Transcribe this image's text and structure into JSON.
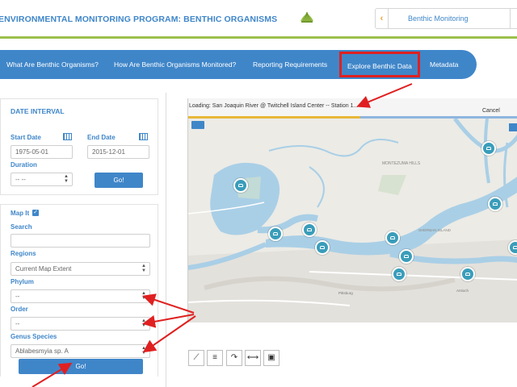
{
  "header": {
    "title": "ENVIRONMENTAL MONITORING PROGRAM: BENTHIC ORGANISMS",
    "program_selector": {
      "value": "Benthic Monitoring",
      "prev_icon": "chevron-left-icon"
    },
    "logo_icon": "shell-logo-icon"
  },
  "nav": {
    "tabs": [
      {
        "label": "What Are Benthic Organisms?"
      },
      {
        "label": "How Are Benthic Organisms Monitored?"
      },
      {
        "label": "Reporting Requirements"
      },
      {
        "label": "Explore Benthic Data",
        "active": true
      },
      {
        "label": "Metadata"
      }
    ]
  },
  "date_interval": {
    "title": "DATE INTERVAL",
    "start_label": "Start Date",
    "start_value": "1975-05-01",
    "end_label": "End Date",
    "end_value": "2015-12-01",
    "duration_label": "Duration",
    "duration_value": "-- --",
    "go_label": "Go!"
  },
  "filters": {
    "map_it_label": "Map It",
    "map_it_checked": true,
    "search_label": "Search",
    "search_value": "",
    "regions_label": "Regions",
    "regions_value": "Current Map Extent",
    "phylum_label": "Phylum",
    "phylum_value": "--",
    "order_label": "Order",
    "order_value": "--",
    "genus_label": "Genus Species",
    "genus_value": "Ablabesmyia sp. A",
    "go_label": "Go!"
  },
  "map": {
    "status_text": "Loading: San Joaquin River @ Twitchell Island Center -- Station 1...",
    "cancel_label": "Cancel",
    "progress": 0.52,
    "station_count_visible": 11,
    "place_labels": [
      "MONTEZUMA HILLS",
      "SHERMAN ISLAND",
      "Pittsburg",
      "Antioch"
    ]
  },
  "toolbar": {
    "tools": [
      "draw-line-icon",
      "legend-lines-icon",
      "redo-arrow-icon",
      "pan-extent-icon",
      "save-disk-icon"
    ]
  },
  "colors": {
    "brand_blue": "#3f86c9",
    "accent_green": "#9cc04c",
    "highlight_red": "#e02020",
    "marker_teal": "#3a9dba",
    "water": "#a9cfe6"
  }
}
